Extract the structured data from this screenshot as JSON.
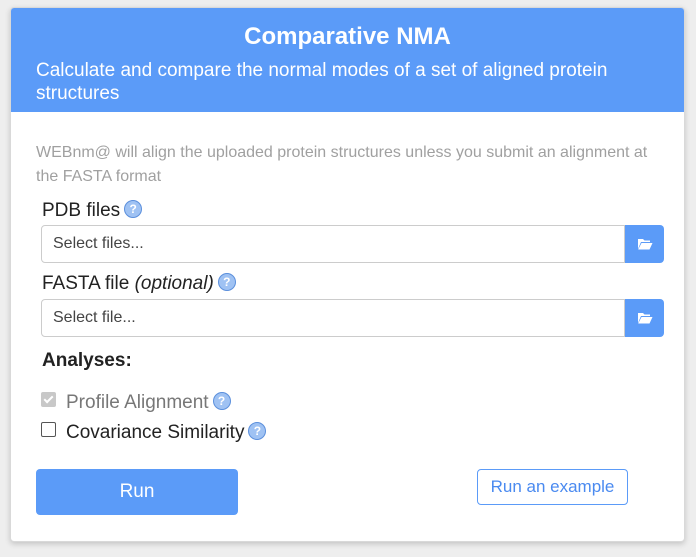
{
  "header": {
    "title": "Comparative NMA",
    "subtitle": "Calculate and compare the normal modes of a set of aligned protein structures"
  },
  "intro": "WEBnm@ will align the uploaded protein structures unless you submit an alignment at the FASTA format",
  "pdb": {
    "label": "PDB files",
    "placeholder": "Select files...",
    "help_icon": "question-circle-icon",
    "browse_icon": "folder-open-icon"
  },
  "fasta": {
    "label": "FASTA file",
    "label_optional": "(optional)",
    "placeholder": "Select file...",
    "help_icon": "question-circle-icon",
    "browse_icon": "folder-open-icon"
  },
  "analyses": {
    "label": "Analyses:",
    "options": [
      {
        "label": "Profile Alignment",
        "checked": true,
        "disabled": true
      },
      {
        "label": "Covariance Similarity",
        "checked": false,
        "disabled": false
      }
    ]
  },
  "help_glyph": "?",
  "buttons": {
    "run": "Run",
    "example": "Run an example"
  },
  "colors": {
    "accent": "#5b9bf8",
    "header_text": "#ffffff"
  }
}
